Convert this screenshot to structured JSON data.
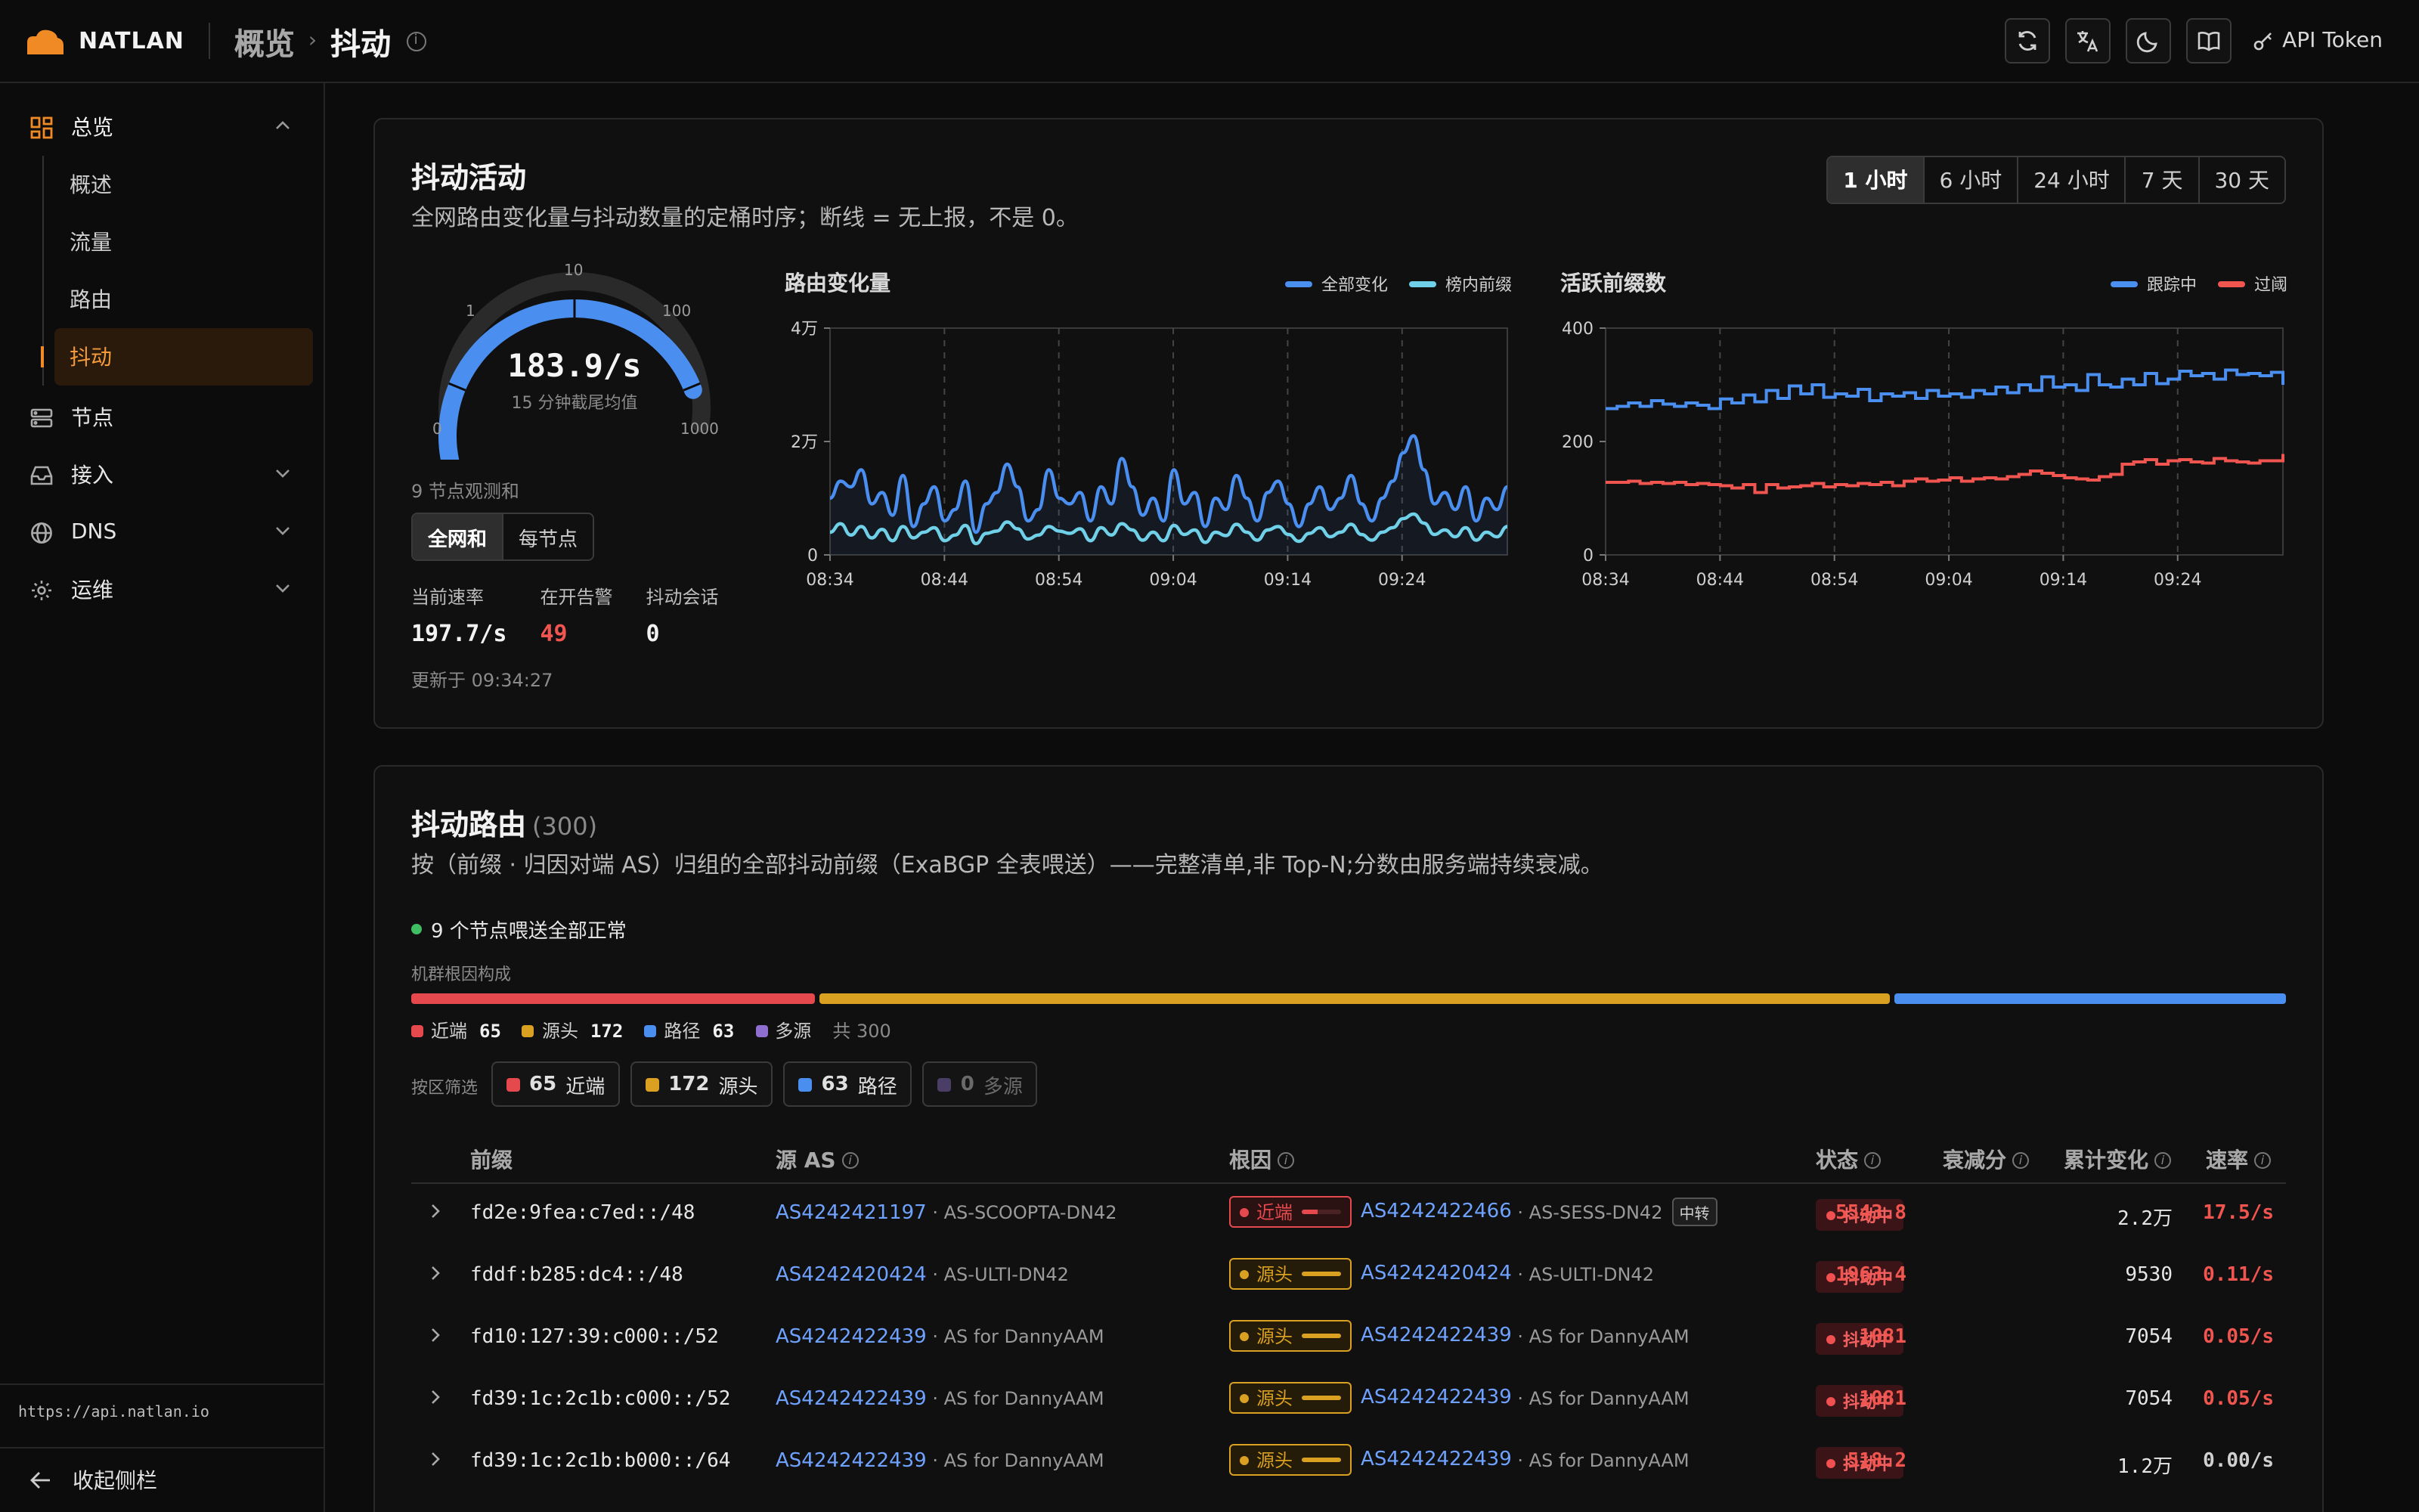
{
  "brand": {
    "name": "NATLAN"
  },
  "breadcrumb": {
    "parent": "概览",
    "current": "抖动"
  },
  "topbar": {
    "token_label": "API Token"
  },
  "sidebar": {
    "groups": [
      {
        "label": "总览",
        "children": [
          "概述",
          "流量",
          "路由",
          "抖动"
        ],
        "active_child": "抖动"
      },
      {
        "label": "节点"
      },
      {
        "label": "接入"
      },
      {
        "label": "DNS"
      },
      {
        "label": "运维"
      }
    ],
    "api_url": "https://api.natlan.io",
    "collapse_label": "收起侧栏"
  },
  "activity": {
    "title": "抖动活动",
    "desc": "全网路由变化量与抖动数量的定桶时序；断线 = 无上报，不是 0。",
    "ranges": [
      "1 小时",
      "6 小时",
      "24 小时",
      "7 天",
      "30 天"
    ],
    "active_range": "1 小时",
    "gauge": {
      "value": "183.9/s",
      "numeric": 183.9,
      "sub": "15 分钟截尾均值",
      "ticks": [
        "0",
        "1",
        "10",
        "100",
        "1000"
      ],
      "scale": "log"
    },
    "observed": "9 节点观测和",
    "toggle": [
      "全网和",
      "每节点"
    ],
    "stats": [
      {
        "label": "当前速率",
        "value": "197.7/s"
      },
      {
        "label": "在开告警",
        "value": "49"
      },
      {
        "label": "抖动会话",
        "value": "0"
      }
    ],
    "updated": "更新于 09:34:27"
  },
  "chart_data": [
    {
      "type": "line",
      "title": "路由变化量",
      "x": [
        "08:34",
        "08:44",
        "08:54",
        "09:04",
        "09:14",
        "09:24"
      ],
      "yticks": [
        "0",
        "2万",
        "4万"
      ],
      "ylim": [
        0,
        40000
      ],
      "series": [
        {
          "name": "全部变化",
          "color": "#4a8ff0",
          "values": [
            10000,
            13000,
            12000,
            15000,
            9000,
            11000,
            7000,
            14000,
            5000,
            9000,
            12000,
            6000,
            8000,
            13000,
            4000,
            9000,
            11000,
            16000,
            12000,
            6000,
            8000,
            15000,
            10000,
            9000,
            11000,
            6000,
            12000,
            9000,
            17000,
            12000,
            7000,
            10000,
            6000,
            15000,
            9000,
            11000,
            5000,
            10000,
            8000,
            14000,
            10000,
            6000,
            11000,
            13000,
            9000,
            5000,
            9000,
            12000,
            8000,
            10000,
            14000,
            9000,
            6000,
            10000,
            13000,
            18000,
            21000,
            15000,
            9000,
            11000,
            8000,
            12000,
            6000,
            10000,
            8000,
            12000
          ]
        },
        {
          "name": "榜内前缀",
          "color": "#6fd0e8",
          "values": [
            4000,
            5500,
            3500,
            5000,
            3000,
            4500,
            2500,
            5000,
            3000,
            4000,
            4800,
            2500,
            3500,
            5200,
            2000,
            3800,
            4200,
            5800,
            4600,
            2800,
            3500,
            5000,
            4200,
            3800,
            4600,
            2500,
            4800,
            3500,
            5500,
            4400,
            2600,
            4000,
            2500,
            5200,
            3600,
            4400,
            2200,
            4000,
            3400,
            5400,
            4000,
            2600,
            4400,
            5000,
            3600,
            2400,
            3800,
            4800,
            3200,
            4000,
            5400,
            3600,
            2600,
            4000,
            4800,
            6400,
            7200,
            5600,
            3600,
            4400,
            3200,
            4800,
            2600,
            4000,
            3200,
            5000
          ]
        }
      ]
    },
    {
      "type": "line",
      "title": "活跃前缀数",
      "x": [
        "08:34",
        "08:44",
        "08:54",
        "09:04",
        "09:14",
        "09:24"
      ],
      "yticks": [
        "0",
        "200",
        "400"
      ],
      "ylim": [
        0,
        400
      ],
      "series": [
        {
          "name": "跟踪中",
          "color": "#4a8ff0",
          "values": [
            258,
            262,
            268,
            262,
            272,
            266,
            262,
            268,
            264,
            258,
            275,
            268,
            282,
            270,
            290,
            276,
            298,
            284,
            300,
            278,
            284,
            280,
            292,
            272,
            284,
            280,
            286,
            276,
            290,
            280,
            284,
            278,
            290,
            284,
            296,
            286,
            300,
            290,
            314,
            296,
            300,
            290,
            318,
            300,
            296,
            310,
            300,
            320,
            302,
            310,
            324,
            316,
            320,
            310,
            326,
            318,
            320,
            316,
            322,
            300
          ]
        },
        {
          "name": "过阈",
          "color": "#f0554f",
          "values": [
            128,
            128,
            130,
            126,
            128,
            126,
            128,
            124,
            126,
            124,
            122,
            118,
            124,
            110,
            124,
            118,
            120,
            122,
            126,
            120,
            124,
            122,
            126,
            124,
            128,
            122,
            130,
            134,
            130,
            132,
            136,
            130,
            134,
            136,
            134,
            138,
            142,
            148,
            144,
            140,
            136,
            134,
            132,
            138,
            142,
            160,
            164,
            168,
            160,
            166,
            168,
            164,
            162,
            170,
            166,
            164,
            162,
            166,
            166,
            178
          ]
        }
      ]
    }
  ],
  "routes": {
    "title": "抖动路由",
    "count": "(300)",
    "desc": "按（前缀 · 归因对端 AS）归组的全部抖动前缀（ExaBGP 全表喂送）——完整清单,非 Top-N;分数由服务端持续衰减。",
    "feed_status": "9 个节点喂送全部正常",
    "composition_label": "机群根因构成",
    "composition": {
      "near": 65,
      "source": 172,
      "path": 63,
      "multi": 0,
      "total": 300
    },
    "legend": {
      "near": "近端",
      "source": "源头",
      "path": "路径",
      "multi": "多源",
      "total": "共 300"
    },
    "filter_label": "按区筛选",
    "filters": [
      {
        "n": "65",
        "label": "近端"
      },
      {
        "n": "172",
        "label": "源头"
      },
      {
        "n": "63",
        "label": "路径"
      },
      {
        "n": "0",
        "label": "多源"
      }
    ],
    "columns": {
      "prefix": "前缀",
      "src_as": "源 AS",
      "cause": "根因",
      "status": "状态",
      "score": "衰减分",
      "cum": "累计变化",
      "rate": "速率"
    },
    "rows": [
      {
        "prefix": "fd2e:9fea:c7ed::/48",
        "src_as": "AS4242421197",
        "src_name": "AS-SCOOPTA-DN42",
        "cause": "近端",
        "cause_as": "AS4242422466",
        "cause_name": "AS-SESS-DN42",
        "relay": "中转",
        "status": "抖动中",
        "score": "5543.8",
        "cum": "2.2万",
        "rate": "17.5/s"
      },
      {
        "prefix": "fddf:b285:dc4::/48",
        "src_as": "AS4242420424",
        "src_name": "AS-ULTI-DN42",
        "cause": "源头",
        "cause_as": "AS4242420424",
        "cause_name": "AS-ULTI-DN42",
        "relay": "",
        "status": "抖动中",
        "score": "1963.4",
        "cum": "9530",
        "rate": "0.11/s"
      },
      {
        "prefix": "fd10:127:39:c000::/52",
        "src_as": "AS4242422439",
        "src_name": "AS for DannyAAM",
        "cause": "源头",
        "cause_as": "AS4242422439",
        "cause_name": "AS for DannyAAM",
        "relay": "",
        "status": "抖动中",
        "score": "1081",
        "cum": "7054",
        "rate": "0.05/s"
      },
      {
        "prefix": "fd39:1c:2c1b:c000::/52",
        "src_as": "AS4242422439",
        "src_name": "AS for DannyAAM",
        "cause": "源头",
        "cause_as": "AS4242422439",
        "cause_name": "AS for DannyAAM",
        "relay": "",
        "status": "抖动中",
        "score": "1081",
        "cum": "7054",
        "rate": "0.05/s"
      },
      {
        "prefix": "fd39:1c:2c1b:b000::/64",
        "src_as": "AS4242422439",
        "src_name": "AS for DannyAAM",
        "cause": "源头",
        "cause_as": "AS4242422439",
        "cause_name": "AS for DannyAAM",
        "relay": "",
        "status": "抖动中",
        "score": "518.2",
        "cum": "1.2万",
        "rate": "0.00/s"
      }
    ]
  },
  "colors": {
    "accent": "#f08a24",
    "near": "#e5484d",
    "source": "#d9a021",
    "path": "#4a8ff0",
    "multi": "#8e6fd0",
    "danger": "#f0554f"
  }
}
